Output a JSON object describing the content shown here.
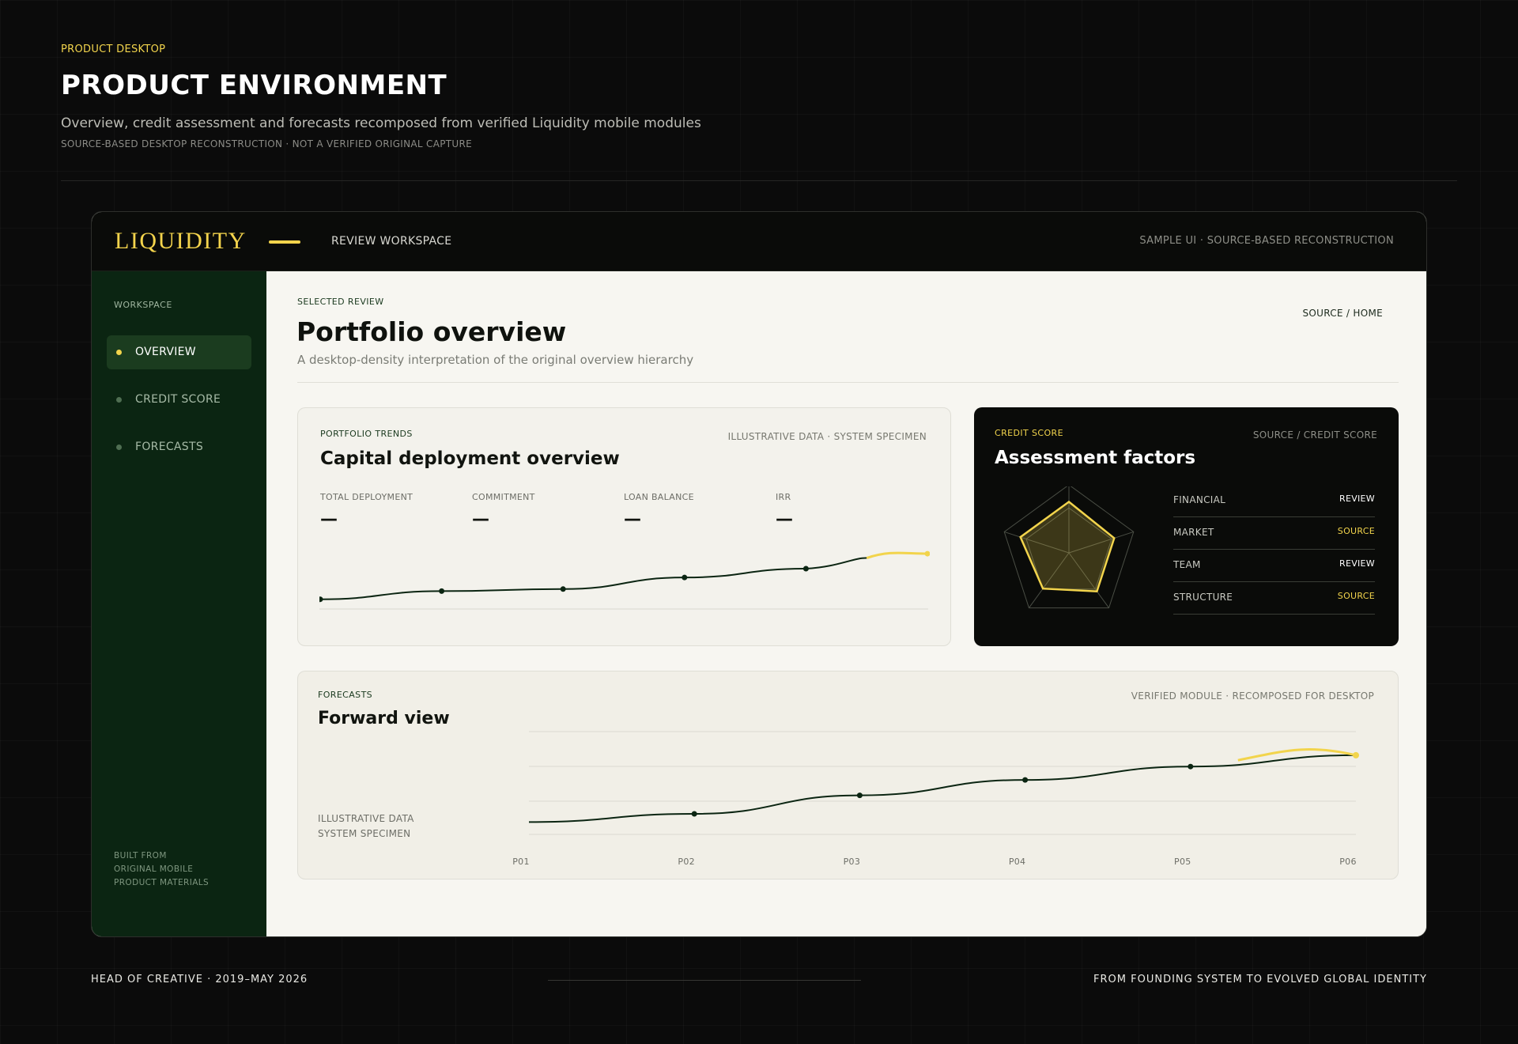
{
  "header": {
    "eyebrow": "PRODUCT DESKTOP",
    "title": "PRODUCT ENVIRONMENT",
    "subtitle": "Overview, credit assessment and forecasts recomposed from verified Liquidity mobile modules",
    "note": "SOURCE-BASED DESKTOP RECONSTRUCTION · NOT A VERIFIED ORIGINAL CAPTURE"
  },
  "app": {
    "logo": "LIQUIDITY",
    "workspace": "REVIEW WORKSPACE",
    "meta": "SAMPLE UI · SOURCE-BASED RECONSTRUCTION"
  },
  "sidebar": {
    "heading": "WORKSPACE",
    "items": [
      {
        "label": "OVERVIEW",
        "active": true
      },
      {
        "label": "CREDIT SCORE",
        "active": false
      },
      {
        "label": "FORECASTS",
        "active": false
      }
    ],
    "footer": [
      "BUILT FROM",
      "ORIGINAL MOBILE",
      "PRODUCT MATERIALS"
    ]
  },
  "main": {
    "selected_label": "SELECTED REVIEW",
    "title": "Portfolio overview",
    "subtitle": "A desktop-density interpretation of the original overview hierarchy",
    "source_link": "SOURCE / HOME"
  },
  "trends_card": {
    "eyebrow": "PORTFOLIO TRENDS",
    "meta": "ILLUSTRATIVE DATA · SYSTEM SPECIMEN",
    "title": "Capital deployment overview",
    "metrics": [
      {
        "label": "TOTAL DEPLOYMENT",
        "value": "—"
      },
      {
        "label": "COMMITMENT",
        "value": "—"
      },
      {
        "label": "LOAN BALANCE",
        "value": "—"
      },
      {
        "label": "IRR",
        "value": "—"
      }
    ]
  },
  "credit_card": {
    "eyebrow": "CREDIT SCORE",
    "meta": "SOURCE / CREDIT SCORE",
    "title": "Assessment factors",
    "factors": [
      {
        "name": "FINANCIAL",
        "status": "REVIEW",
        "status_color": "#ffffff"
      },
      {
        "name": "MARKET",
        "status": "SOURCE",
        "status_color": "#f2d44c"
      },
      {
        "name": "TEAM",
        "status": "REVIEW",
        "status_color": "#ffffff"
      },
      {
        "name": "STRUCTURE",
        "status": "SOURCE",
        "status_color": "#f2d44c"
      }
    ]
  },
  "forecast_card": {
    "eyebrow": "FORECASTS",
    "meta": "VERIFIED MODULE · RECOMPOSED FOR DESKTOP",
    "title": "Forward view",
    "note_line1": "ILLUSTRATIVE DATA",
    "note_line2": "SYSTEM SPECIMEN"
  },
  "chart_data": [
    {
      "type": "line",
      "series": [
        {
          "values": [
            0.05,
            0.17,
            0.2,
            0.37,
            0.5,
            0.72
          ]
        }
      ],
      "highlight_color": "#f2d44c",
      "line_color": "#0b2512"
    },
    {
      "type": "radar",
      "axes": 5,
      "values": [
        0.75,
        0.7,
        0.7,
        0.65,
        0.75
      ],
      "highlight_color": "#f2d44c"
    },
    {
      "type": "line",
      "categories": [
        "P01",
        "P02",
        "P03",
        "P04",
        "P05",
        "P06"
      ],
      "series": [
        {
          "values": [
            0.12,
            0.2,
            0.38,
            0.53,
            0.66,
            0.77
          ]
        }
      ],
      "grid": true,
      "highlight_color": "#f2d44c",
      "line_color": "#0b2512"
    }
  ],
  "footer": {
    "left": "HEAD OF CREATIVE · 2019–MAY 2026",
    "right": "FROM FOUNDING SYSTEM TO EVOLVED GLOBAL IDENTITY"
  },
  "colors": {
    "accent": "#f2d44c",
    "sidebar": "#0b2512",
    "dark_panel": "#0a0b09",
    "canvas": "#f7f6f1"
  }
}
